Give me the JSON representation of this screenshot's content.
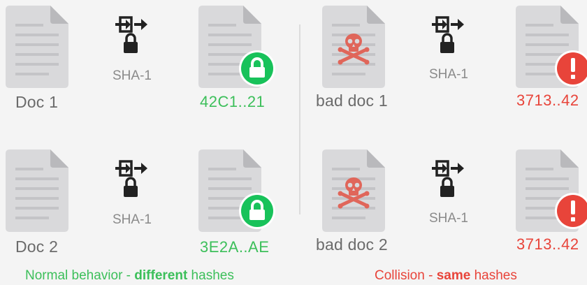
{
  "left": {
    "rows": [
      {
        "doc_label": "Doc 1",
        "hash_function": "SHA-1",
        "hash": "42C1..21"
      },
      {
        "doc_label": "Doc 2",
        "hash_function": "SHA-1",
        "hash": "3E2A..AE"
      }
    ],
    "caption": {
      "prefix": "Normal behavior - ",
      "emphasis": "different",
      "suffix": " hashes"
    }
  },
  "right": {
    "rows": [
      {
        "doc_label": "bad doc 1",
        "hash_function": "SHA-1",
        "hash": "3713..42"
      },
      {
        "doc_label": "bad doc 2",
        "hash_function": "SHA-1",
        "hash": "3713..42"
      }
    ],
    "caption": {
      "prefix": "Collision - ",
      "emphasis": "same",
      "suffix": " hashes"
    }
  },
  "colors": {
    "ok": "#3cbf5a",
    "bad": "#e8443a",
    "doc": "#d9d9db",
    "text": "#6b6b6b"
  },
  "icons": [
    "document-icon",
    "skull-crossbones-icon",
    "hash-function-icon",
    "lock-icon",
    "lock-badge-icon",
    "alert-badge-icon"
  ]
}
